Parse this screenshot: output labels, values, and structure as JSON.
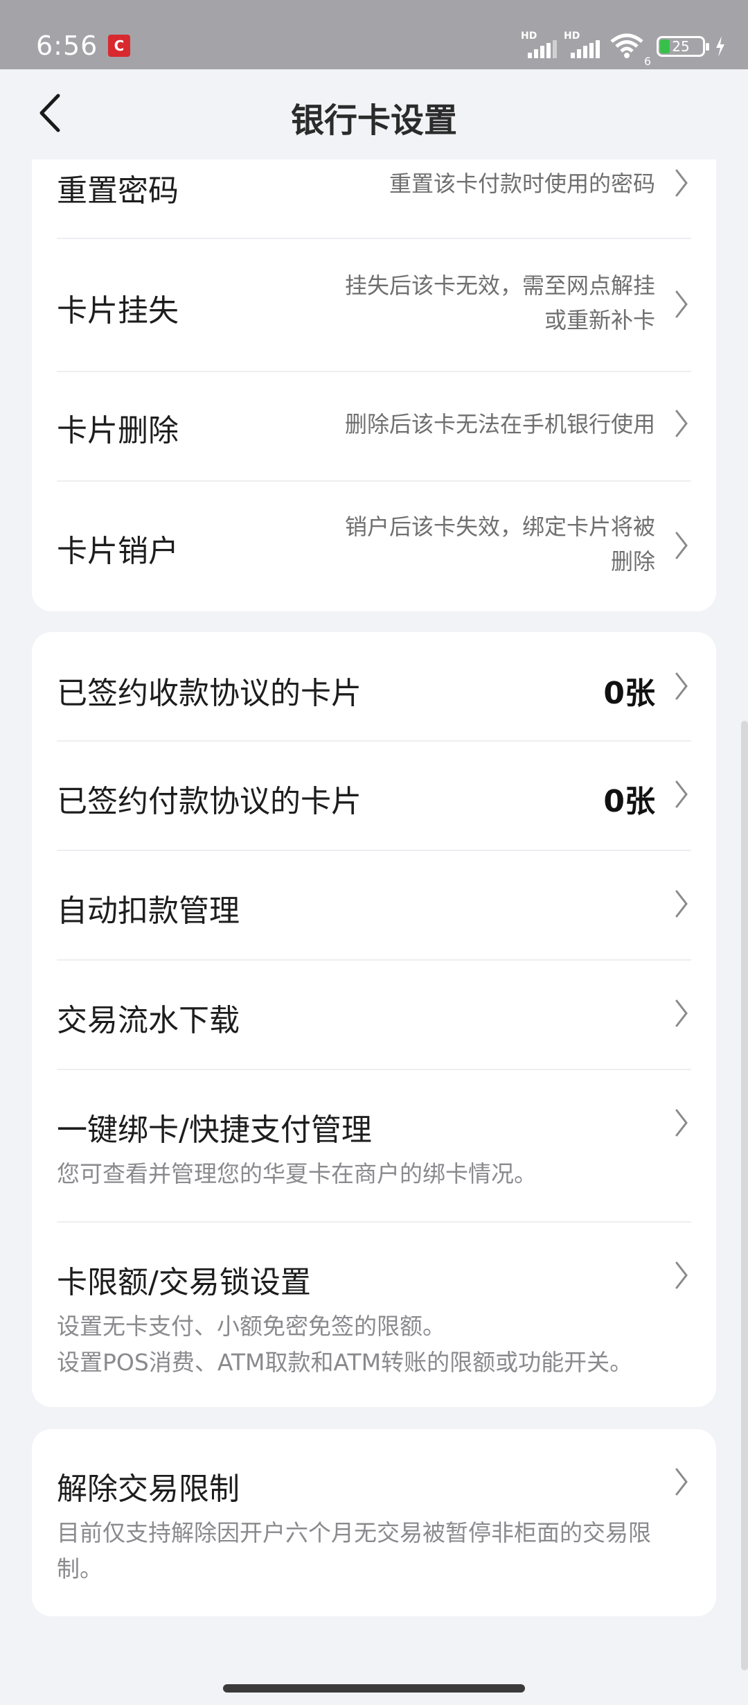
{
  "status_bar": {
    "time": "6:56",
    "app_badge": "C",
    "signal_1": "HD",
    "signal_2": "HD",
    "wifi_sub": "6",
    "battery": "25"
  },
  "header": {
    "title": "银行卡设置"
  },
  "card1": {
    "rows": [
      {
        "label": "重置密码",
        "desc": [
          "重置该卡付款时使用的密码"
        ]
      },
      {
        "label": "卡片挂失",
        "desc": [
          "挂失后该卡无效，需至网点解挂",
          "或重新补卡"
        ]
      },
      {
        "label": "卡片删除",
        "desc": [
          "删除后该卡无法在手机银行使用"
        ]
      },
      {
        "label": "卡片销户",
        "desc": [
          "销户后该卡失效，绑定卡片将被",
          "删除"
        ]
      }
    ]
  },
  "card2": {
    "rows": [
      {
        "label": "已签约收款协议的卡片",
        "value": "0张"
      },
      {
        "label": "已签约付款协议的卡片",
        "value": "0张"
      },
      {
        "label": "自动扣款管理"
      },
      {
        "label": "交易流水下载"
      },
      {
        "label": "一键绑卡/快捷支付管理",
        "sub": [
          "您可查看并管理您的华夏卡在商户的绑卡情况。"
        ]
      },
      {
        "label": "卡限额/交易锁设置",
        "sub": [
          "设置无卡支付、小额免密免签的限额。",
          "设置POS消费、ATM取款和ATM转账的限额或功能开关。"
        ]
      }
    ]
  },
  "card3": {
    "rows": [
      {
        "label": "解除交易限制",
        "sub": [
          "目前仅支持解除因开户六个月无交易被暂停非柜面的交易限",
          "制。"
        ]
      }
    ]
  },
  "colors": {
    "background": "#f2f3f7",
    "card": "#ffffff",
    "status_bar": "#a3a3a8",
    "battery_fill": "#37c04a"
  }
}
